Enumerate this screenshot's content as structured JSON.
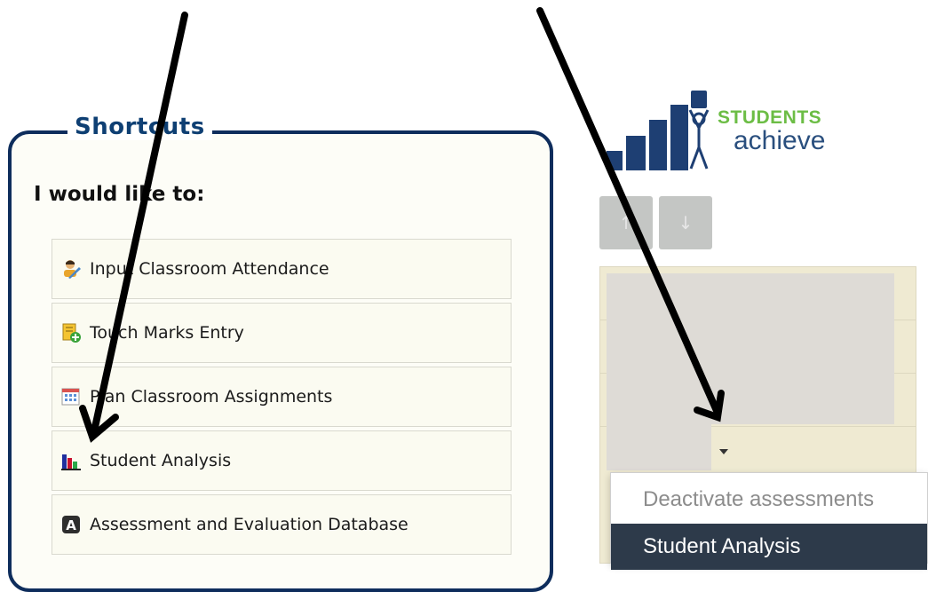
{
  "shortcuts": {
    "legend": "Shortcuts",
    "prompt": "I would like to:",
    "items": [
      {
        "label": "Input Classroom Attendance",
        "icon": "attendance-icon"
      },
      {
        "label": "Touch Marks Entry",
        "icon": "marks-entry-icon"
      },
      {
        "label": "Plan Classroom Assignments",
        "icon": "calendar-icon"
      },
      {
        "label": "Student Analysis",
        "icon": "bar-chart-icon"
      },
      {
        "label": "Assessment and Evaluation Database",
        "icon": "letter-a-icon"
      }
    ]
  },
  "logo": {
    "line1": "STUDENTS",
    "line2": "achieve",
    "colors": {
      "green": "#6cbd45",
      "blue": "#1e3f73"
    }
  },
  "nav": {
    "buttons": [
      {
        "icon": "arrow-up-icon",
        "glyph": "↑"
      },
      {
        "icon": "arrow-down-icon",
        "glyph": "↓"
      }
    ]
  },
  "menu": {
    "items": [
      {
        "label": "Deactivate assessments",
        "state": "normal"
      },
      {
        "label": "Student Analysis",
        "state": "highlighted"
      }
    ]
  },
  "colors": {
    "panel_border": "#0e2d5c",
    "highlight": "#2d3a4a",
    "grid_bg": "#efead2"
  }
}
